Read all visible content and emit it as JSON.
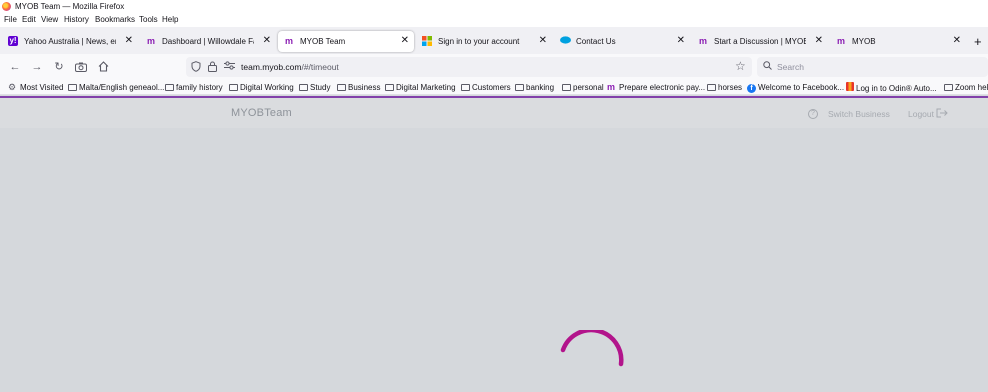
{
  "window": {
    "title": "MYOB Team — Mozilla Firefox"
  },
  "menu": [
    "File",
    "Edit",
    "View",
    "History",
    "Bookmarks",
    "Tools",
    "Help"
  ],
  "tabs": [
    {
      "label": "Yahoo Australia | News, email and",
      "favicon": "yahoo-icon",
      "active": false
    },
    {
      "label": "Dashboard | Willowdale Farm | M",
      "favicon": "myob-icon",
      "active": false
    },
    {
      "label": "MYOB Team",
      "favicon": "myob-icon",
      "active": true
    },
    {
      "label": "Sign in to your account",
      "favicon": "microsoft-icon",
      "active": false
    },
    {
      "label": "Contact Us",
      "favicon": "salesforce-icon",
      "active": false
    },
    {
      "label": "Start a Discussion | MYOB Comm",
      "favicon": "myob-icon",
      "active": false
    },
    {
      "label": "MYOB",
      "favicon": "myob-icon",
      "active": false
    }
  ],
  "tab_close_glyph": "✕",
  "new_tab_glyph": "+",
  "navbar": {
    "url_domain": "team.myob.com",
    "url_path": "/#/timeout",
    "search_placeholder": "Search"
  },
  "bookmarks": [
    {
      "label": "Most Visited",
      "icon": "gear-icon"
    },
    {
      "label": "Malta/English geneaol...",
      "icon": "folder-icon"
    },
    {
      "label": "family history",
      "icon": "folder-icon"
    },
    {
      "label": "Digital Working",
      "icon": "folder-icon"
    },
    {
      "label": "Study",
      "icon": "folder-icon"
    },
    {
      "label": "Business",
      "icon": "folder-icon"
    },
    {
      "label": "Digital Marketing",
      "icon": "folder-icon"
    },
    {
      "label": "Customers",
      "icon": "folder-icon"
    },
    {
      "label": "banking",
      "icon": "folder-icon"
    },
    {
      "label": "personal",
      "icon": "folder-icon"
    },
    {
      "label": "Prepare electronic pay...",
      "icon": "myob-icon"
    },
    {
      "label": "horses",
      "icon": "folder-icon"
    },
    {
      "label": "Welcome to Facebook...",
      "icon": "facebook-icon"
    },
    {
      "label": "Log in to Odin® Auto...",
      "icon": "odin-icon"
    },
    {
      "label": "Zoom help",
      "icon": "folder-icon"
    }
  ],
  "app": {
    "brand": "MYOBTeam",
    "switch_business": "Switch Business",
    "logout": "Logout",
    "help_glyph": "?",
    "accent_color": "#8241aa",
    "spinner_color": "#b2148b"
  }
}
